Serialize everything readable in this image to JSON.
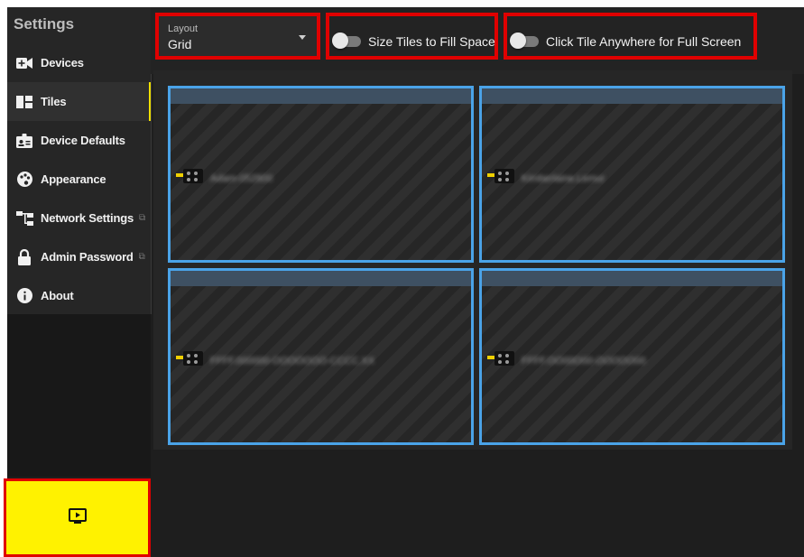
{
  "sidebar": {
    "title": "Settings",
    "items": [
      {
        "label": "Devices",
        "icon": "video-plus-icon"
      },
      {
        "label": "Tiles",
        "icon": "tiles-icon",
        "active": true
      },
      {
        "label": "Device Defaults",
        "icon": "id-badge-icon"
      },
      {
        "label": "Appearance",
        "icon": "palette-icon"
      },
      {
        "label": "Network Settings",
        "icon": "network-icon",
        "external": true
      },
      {
        "label": "Admin Password",
        "icon": "lock-icon",
        "external": true
      },
      {
        "label": "About",
        "icon": "info-icon"
      }
    ],
    "footer_button_icon": "play-screen-icon"
  },
  "toolbar": {
    "layout": {
      "label": "Layout",
      "value": "Grid"
    },
    "size_tiles_toggle": {
      "label": "Size Tiles to Fill Space",
      "on": false
    },
    "click_tile_toggle": {
      "label": "Click Tile Anywhere for Full Screen",
      "on": false
    }
  },
  "tiles": [
    {
      "name": "Adam-052800"
    },
    {
      "name": "Kimberlaine.Lemur"
    },
    {
      "name": "FFFF.000000-OOOOOOO-CCCC.XX"
    },
    {
      "name": "FFFF.OO00O00-OOOOO00"
    }
  ],
  "colors": {
    "accent_yellow": "#fff200",
    "highlight_red": "#e00000",
    "tile_border_blue": "#4aa3e8"
  }
}
